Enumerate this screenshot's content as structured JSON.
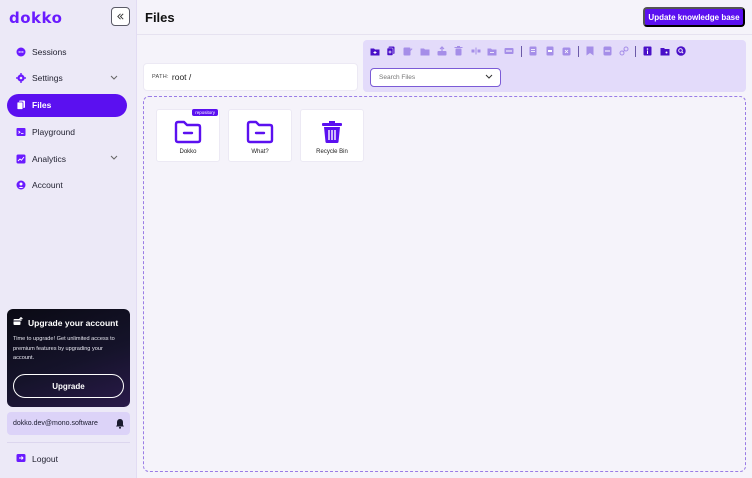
{
  "app": {
    "logo": "dokko",
    "page_title": "Files",
    "update_button": "Update knowledge base"
  },
  "sidebar": {
    "items": [
      {
        "label": "Sessions",
        "icon": "chat-bubble-icon",
        "active": false,
        "expandable": false
      },
      {
        "label": "Settings",
        "icon": "gear-icon",
        "active": false,
        "expandable": true
      },
      {
        "label": "Files",
        "icon": "files-icon",
        "active": true,
        "expandable": false
      },
      {
        "label": "Playground",
        "icon": "terminal-icon",
        "active": false,
        "expandable": false
      },
      {
        "label": "Analytics",
        "icon": "chart-icon",
        "active": false,
        "expandable": true
      },
      {
        "label": "Account",
        "icon": "user-circle-icon",
        "active": false,
        "expandable": false
      }
    ],
    "upgrade": {
      "title": "Upgrade your account",
      "text": "Time to upgrade! Get unlimited access to premium features by upgrading your account.",
      "button": "Upgrade"
    },
    "user_email": "dokko.dev@mono.software",
    "logout": "Logout"
  },
  "path": {
    "label": "PATH:",
    "value": "root /"
  },
  "toolbar": {
    "icons": [
      "add-folder-icon",
      "add-files-icon",
      "edit-icon",
      "open-folder-icon",
      "upload-icon",
      "delete-icon",
      "split-icon",
      "move-folder-icon",
      "embed-icon",
      "document-icon",
      "copy-document-icon",
      "close-document-icon",
      "bookmark-icon",
      "archive-icon",
      "link-icon",
      "file-info-icon",
      "folder-tag-icon",
      "search-circle-icon"
    ],
    "search_placeholder": "Search Files"
  },
  "files": [
    {
      "name": "Dokko",
      "type": "folder",
      "badge": "repository"
    },
    {
      "name": "What?",
      "type": "folder",
      "badge": ""
    },
    {
      "name": "Recycle Bin",
      "type": "trash",
      "badge": ""
    }
  ],
  "colors": {
    "accent": "#5b10f0",
    "sidebar_bg": "#ece9f7",
    "toolbar_bg": "#e3dbfa"
  }
}
